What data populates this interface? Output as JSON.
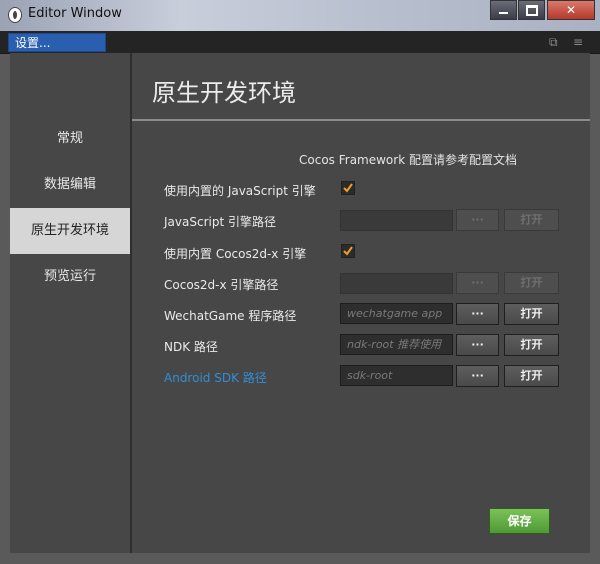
{
  "window": {
    "title": "Editor Window"
  },
  "tab": {
    "label": "设置..."
  },
  "sidebar": {
    "items": [
      {
        "label": "常规"
      },
      {
        "label": "数据编辑"
      },
      {
        "label": "原生开发环境"
      },
      {
        "label": "预览运行"
      }
    ]
  },
  "page": {
    "title": "原生开发环境",
    "note": "Cocos Framework 配置请参考配置文档",
    "rows": [
      {
        "label": "使用内置的 JavaScript 引擎",
        "checked": true
      },
      {
        "label": "JavaScript 引擎路径",
        "placeholder": ""
      },
      {
        "label": "使用内置 Cocos2d-x 引擎",
        "checked": true
      },
      {
        "label": "Cocos2d-x 引擎路径",
        "placeholder": ""
      },
      {
        "label": "WechatGame 程序路径",
        "placeholder": "wechatgame app"
      },
      {
        "label": "NDK 路径",
        "placeholder": "ndk-root 推荐使用"
      },
      {
        "label": "Android SDK 路径",
        "placeholder": "sdk-root"
      }
    ],
    "browse_label": "···",
    "open_label": "打开",
    "save_label": "保存"
  },
  "colors": {
    "accent_tab": "#2a5fb0",
    "link": "#2f8fd8",
    "save": "#5ea83f",
    "checkbox": "#f0a020"
  }
}
